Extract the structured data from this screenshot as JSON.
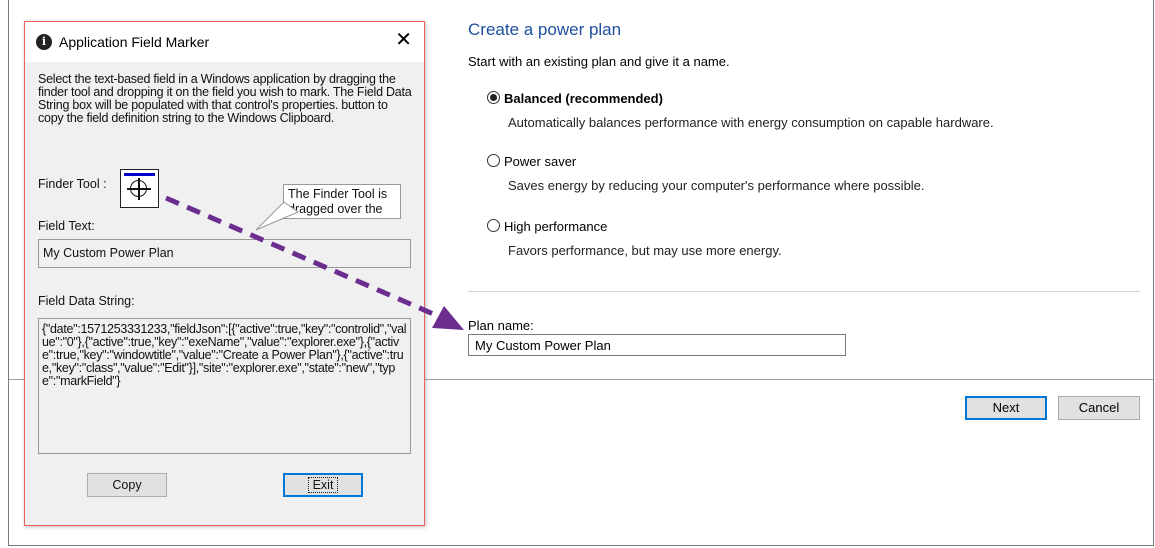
{
  "power_plan": {
    "title": "Create a power plan",
    "subtitle": "Start with an existing plan and give it a name.",
    "options": [
      {
        "label": "Balanced (recommended)",
        "description": "Automatically balances performance with energy consumption on capable hardware.",
        "selected": true
      },
      {
        "label": "Power saver",
        "description": "Saves energy by reducing your computer's performance where possible.",
        "selected": false
      },
      {
        "label": "High performance",
        "description": "Favors performance, but may use more energy.",
        "selected": false
      }
    ],
    "plan_name_label": "Plan name:",
    "plan_name_value": "My Custom Power Plan",
    "next_label": "Next",
    "cancel_label": "Cancel"
  },
  "dialog": {
    "title": "Application Field Marker",
    "close_glyph": "✕",
    "instructions": "Select the text-based field in a Windows application by dragging the finder tool and dropping it on the field you wish to mark.  The Field Data String box will be populated with that control's properties. button to copy the field definition string to the Windows Clipboard.",
    "finder_label": "Finder Tool :",
    "callout_text": "The Finder Tool is dragged over the",
    "field_text_label": "Field Text:",
    "field_text_value": "My Custom Power Plan",
    "field_data_label": "Field Data String:",
    "field_data_value": "{\"date\":1571253331233,\"fieldJson\":[{\"active\":true,\"key\":\"controlid\",\"value\":\"0\"},{\"active\":true,\"key\":\"exeName\",\"value\":\"explorer.exe\"},{\"active\":true,\"key\":\"windowtitle\",\"value\":\"Create a Power Plan\"},{\"active\":true,\"key\":\"class\",\"value\":\"Edit\"}],\"site\":\"explorer.exe\",\"state\":\"new\",\"type\":\"markField\"}",
    "copy_label": "Copy",
    "exit_label": "Exit"
  },
  "colors": {
    "title_blue": "#1e4fa0",
    "dialog_border": "#e8615e",
    "arrow_purple": "#6b2d8f",
    "focus_blue": "#0078d7"
  }
}
